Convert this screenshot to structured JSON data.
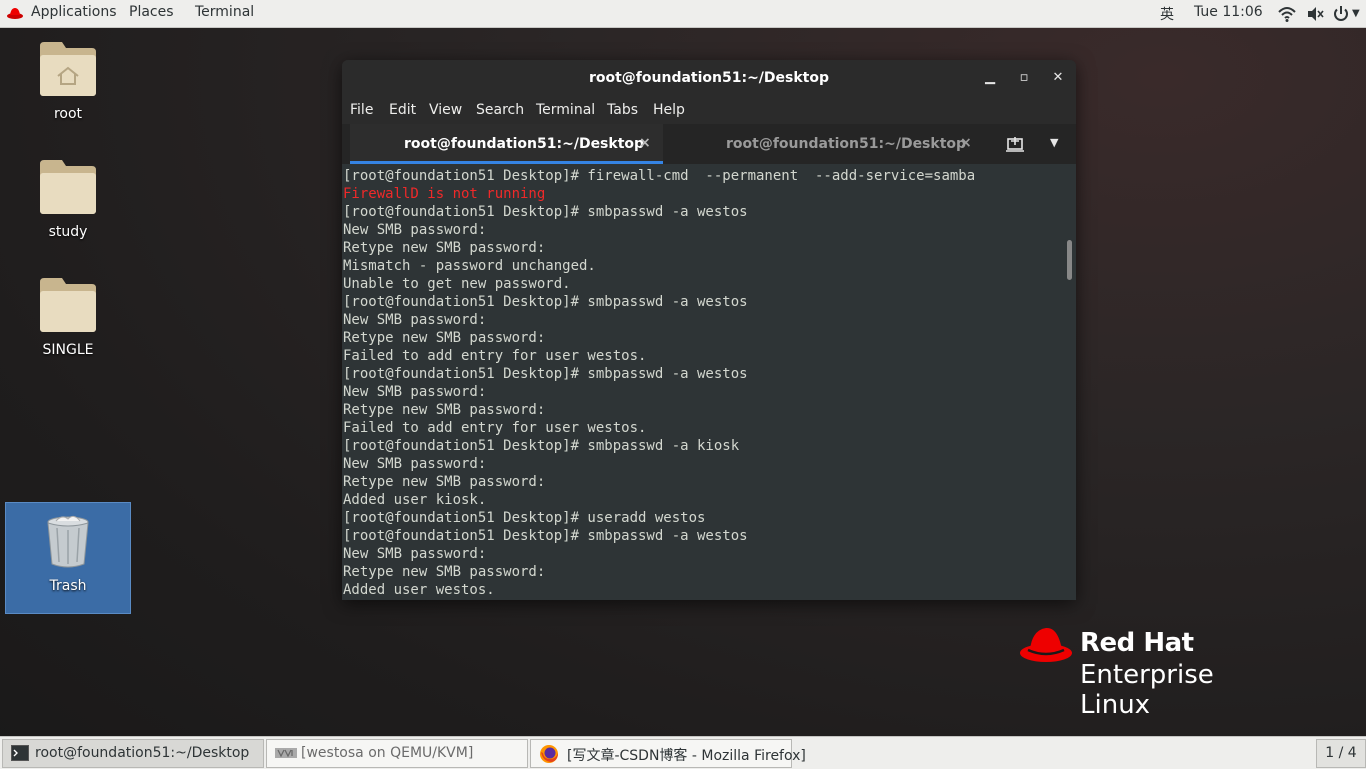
{
  "topbar": {
    "applications": "Applications",
    "places": "Places",
    "terminal": "Terminal",
    "input_method": "英",
    "clock": "Tue 11:06",
    "icons": [
      "wifi-icon",
      "volume-muted-icon",
      "power-icon"
    ]
  },
  "desktop": {
    "icons": [
      {
        "label": "root",
        "icon": "home-folder-icon"
      },
      {
        "label": "study",
        "icon": "folder-icon"
      },
      {
        "label": "SINGLE",
        "icon": "folder-icon"
      },
      {
        "label": "Trash",
        "icon": "trash-icon"
      }
    ]
  },
  "window": {
    "title": "root@foundation51:~/Desktop",
    "menu": [
      "File",
      "Edit",
      "View",
      "Search",
      "Terminal",
      "Tabs",
      "Help"
    ],
    "tabs": [
      {
        "label": "root@foundation51:~/Desktop",
        "active": true
      },
      {
        "label": "root@foundation51:~/Desktop",
        "active": false
      }
    ],
    "terminal_lines": [
      {
        "text": "[root@foundation51 Desktop]# firewall-cmd  --permanent  --add-service=samba",
        "color": "#d3d7cf"
      },
      {
        "text": "FirewallD is not running",
        "color": "#ef2929"
      },
      {
        "text": "[root@foundation51 Desktop]# smbpasswd -a westos",
        "color": "#d3d7cf"
      },
      {
        "text": "New SMB password:",
        "color": "#d3d7cf"
      },
      {
        "text": "Retype new SMB password:",
        "color": "#d3d7cf"
      },
      {
        "text": "Mismatch - password unchanged.",
        "color": "#d3d7cf"
      },
      {
        "text": "Unable to get new password.",
        "color": "#d3d7cf"
      },
      {
        "text": "[root@foundation51 Desktop]# smbpasswd -a westos",
        "color": "#d3d7cf"
      },
      {
        "text": "New SMB password:",
        "color": "#d3d7cf"
      },
      {
        "text": "Retype new SMB password:",
        "color": "#d3d7cf"
      },
      {
        "text": "Failed to add entry for user westos.",
        "color": "#d3d7cf"
      },
      {
        "text": "[root@foundation51 Desktop]# smbpasswd -a westos",
        "color": "#d3d7cf"
      },
      {
        "text": "New SMB password:",
        "color": "#d3d7cf"
      },
      {
        "text": "Retype new SMB password:",
        "color": "#d3d7cf"
      },
      {
        "text": "Failed to add entry for user westos.",
        "color": "#d3d7cf"
      },
      {
        "text": "[root@foundation51 Desktop]# smbpasswd -a kiosk",
        "color": "#d3d7cf"
      },
      {
        "text": "New SMB password:",
        "color": "#d3d7cf"
      },
      {
        "text": "Retype new SMB password:",
        "color": "#d3d7cf"
      },
      {
        "text": "Added user kiosk.",
        "color": "#d3d7cf"
      },
      {
        "text": "[root@foundation51 Desktop]# useradd westos",
        "color": "#d3d7cf"
      },
      {
        "text": "[root@foundation51 Desktop]# smbpasswd -a westos",
        "color": "#d3d7cf"
      },
      {
        "text": "New SMB password:",
        "color": "#d3d7cf"
      },
      {
        "text": "Retype new SMB password:",
        "color": "#d3d7cf"
      },
      {
        "text": "Added user westos.",
        "color": "#d3d7cf"
      }
    ]
  },
  "branding": {
    "line1": "Red Hat",
    "line2": "Enterprise Linux",
    "accent": "#ee0000"
  },
  "taskbar": {
    "items": [
      {
        "label": "root@foundation51:~/Desktop",
        "icon": "terminal-icon",
        "active": true
      },
      {
        "label": "[westosa on QEMU/KVM]",
        "icon": "virt-manager-icon",
        "active": false
      },
      {
        "label": "[写文章-CSDN博客 - Mozilla Firefox]",
        "icon": "firefox-icon",
        "active": false
      }
    ],
    "workspace": "1 / 4"
  }
}
